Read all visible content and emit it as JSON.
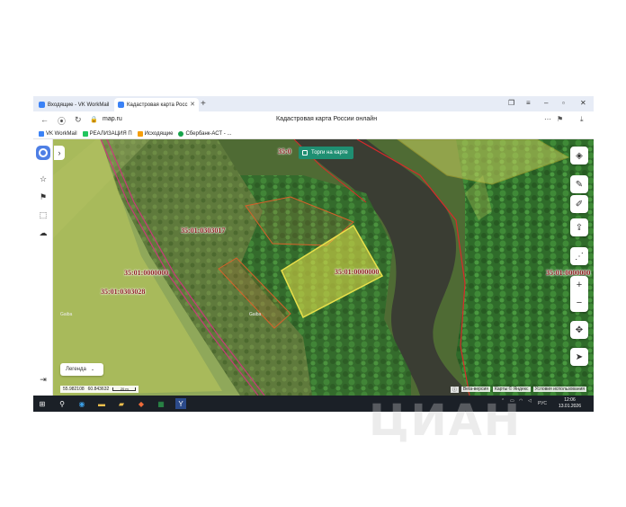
{
  "browser": {
    "tabs": [
      {
        "label": "Входящие - VK WorkMail",
        "fav_color": "#3b82f6"
      },
      {
        "label": "Кадастровая карта Росс",
        "fav_color": "#3b82f6"
      }
    ],
    "new_tab": "+",
    "url": "map.ru",
    "page_title": "Кадастровая карта России онлайн",
    "bookmarks": [
      {
        "label": "VK WorkMail",
        "color": "#3b82f6"
      },
      {
        "label": "РЕАЛИЗАЦИЯ П",
        "color": "#22c55e"
      },
      {
        "label": "Исходящие",
        "color": "#f59e0b"
      },
      {
        "label": "Сбербанк-АСТ - ...",
        "color": "#16a34a"
      }
    ]
  },
  "map": {
    "torgi_button": "Торги на карте",
    "legend_button": "Легенда",
    "coords": {
      "lat": "55.982108",
      "lon": "60.843632",
      "scale": "20 m"
    },
    "attribution": [
      "Beta-версия",
      "Карты © Яндекс",
      "Условия использования"
    ],
    "parcel_labels": [
      "35:0",
      "35:01:0303017",
      "35:01:0000000",
      "35:01:0303028",
      "35:01:0000000",
      "35:01:0000000"
    ],
    "map_faint_labels": [
      "Gaiba",
      "Gaiba"
    ]
  },
  "taskbar": {
    "lang": "РУС",
    "time": "12:06",
    "date": "13.01.2026"
  },
  "watermark": "ЦИАН",
  "colors": {
    "accent": "#4e7fe5",
    "torgi": "#1f8f72",
    "parcel_border": "#d82a2a",
    "selected_parcel": "#e9e04a"
  }
}
